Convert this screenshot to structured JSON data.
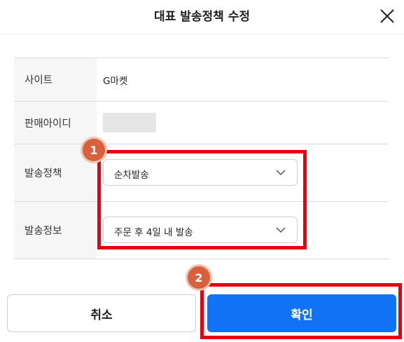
{
  "dialog": {
    "title": "대표 발송정책 수정",
    "close_icon": "close-icon"
  },
  "form": {
    "site": {
      "label": "사이트",
      "value": "G마켓"
    },
    "seller_id": {
      "label": "판매아이디",
      "value_masked": true
    },
    "shipping_policy": {
      "label": "발송정책",
      "selected": "순차발송"
    },
    "shipping_info": {
      "label": "발송정보",
      "selected": "주문 후 4일 내 발송"
    }
  },
  "annotations": {
    "badge_1": "1",
    "badge_2": "2",
    "highlight_color": "#e60012",
    "badge_color": "#d9603c"
  },
  "buttons": {
    "cancel": "취소",
    "confirm": "확인",
    "confirm_color": "#1272f5"
  }
}
